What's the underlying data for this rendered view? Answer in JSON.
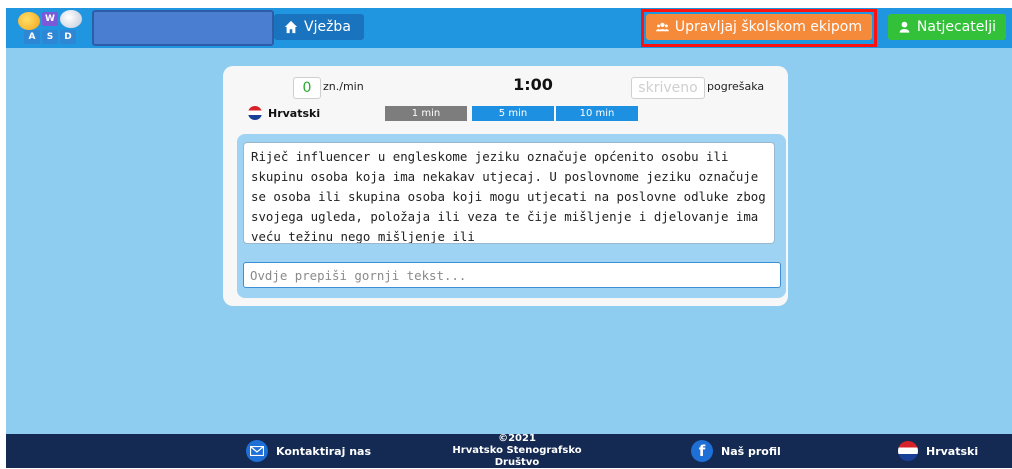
{
  "header": {
    "logo_letters": [
      "W",
      "A",
      "S",
      "D"
    ],
    "nav_exercise": "Vježba",
    "nav_manage_team": "Upravljaj školskom ekipom",
    "nav_competitors": "Natjecatelji",
    "colors": {
      "bar": "#2196e0",
      "exercise": "#1a73be",
      "manage": "#f58a3a",
      "competitors": "#34c13a",
      "highlight": "#ff1010"
    }
  },
  "stats": {
    "wpm_value": "0",
    "wpm_label": "zn./min",
    "timer": "1:00",
    "errors_value": "skriveno",
    "errors_label": "pogrešaka"
  },
  "language": {
    "label": "Hrvatski",
    "icon": "croatia-flag-icon"
  },
  "durations": [
    {
      "label": "1 min",
      "selected": true
    },
    {
      "label": "5 min",
      "selected": false
    },
    {
      "label": "10 min",
      "selected": false
    }
  ],
  "source_text": "Riječ influencer u engleskome jeziku označuje općenito osobu ili skupinu osoba koja ima nekakav utjecaj. U poslovnome jeziku označuje se osoba ili skupina osoba koji mogu utjecati na poslovne odluke zbog svojega ugleda, položaja ili veza te čije mišljenje i djelovanje ima veću težinu nego mišljenje ili",
  "input": {
    "placeholder": "Ovdje prepiši gornji tekst...",
    "value": ""
  },
  "footer": {
    "contact": "Kontaktiraj nas",
    "copyright_year": "©2021",
    "copyright_org": "Hrvatsko Stenografsko Društvo",
    "profile": "Naš profil",
    "language": "Hrvatski"
  }
}
